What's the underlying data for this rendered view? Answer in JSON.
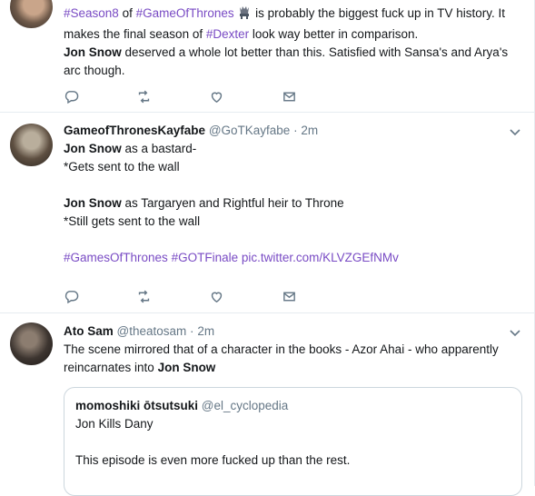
{
  "tweets": [
    {
      "text_parts": {
        "p1": "#Season8",
        "p2": " of ",
        "p3": "#GameOfThrones",
        "p4": " is probably the biggest fuck up in TV history. It makes the final season of ",
        "p5": "#Dexter",
        "p6": " look way better in comparison.",
        "p7": "Jon Snow",
        "p8": " deserved a whole lot better than this. Satisfied with Sansa's and Arya's arc though."
      }
    },
    {
      "name": "GameofThronesKayfabe",
      "handle": "@GoTKayfabe",
      "separator": "·",
      "time": "2m",
      "lines": {
        "l1_bold": "Jon Snow",
        "l1_rest": " as a bastard-",
        "l2": "*Gets sent to the wall",
        "l3_bold": "Jon Snow",
        "l3_rest": " as Targaryen and Rightful heir to Throne",
        "l4": "*Still gets sent to the wall",
        "tag1": "#GamesOfThrones",
        "tag2": "#GOTFinale",
        "link": "pic.twitter.com/KLVZGEfNMv"
      }
    },
    {
      "name": "Ato Sam",
      "handle": "@theatosam",
      "separator": "·",
      "time": "2m",
      "text": "The scene mirrored that of a character in the books - Azor Ahai - who apparently reincarnates into ",
      "text_bold": "Jon Snow",
      "quote": {
        "name": "momoshiki ōtsutsuki",
        "handle": "@el_cyclopedia",
        "line1": "Jon Kills Dany",
        "line2": "This episode is even more fucked up than the rest."
      }
    }
  ],
  "icons": [
    "reply-icon",
    "retweet-icon",
    "like-icon",
    "message-icon",
    "chevron-down-icon",
    "throne-emoji-icon"
  ],
  "colors": {
    "hashtag": "#794bc4",
    "muted": "#657786",
    "text": "#14171a",
    "border": "#e6ecf0"
  }
}
